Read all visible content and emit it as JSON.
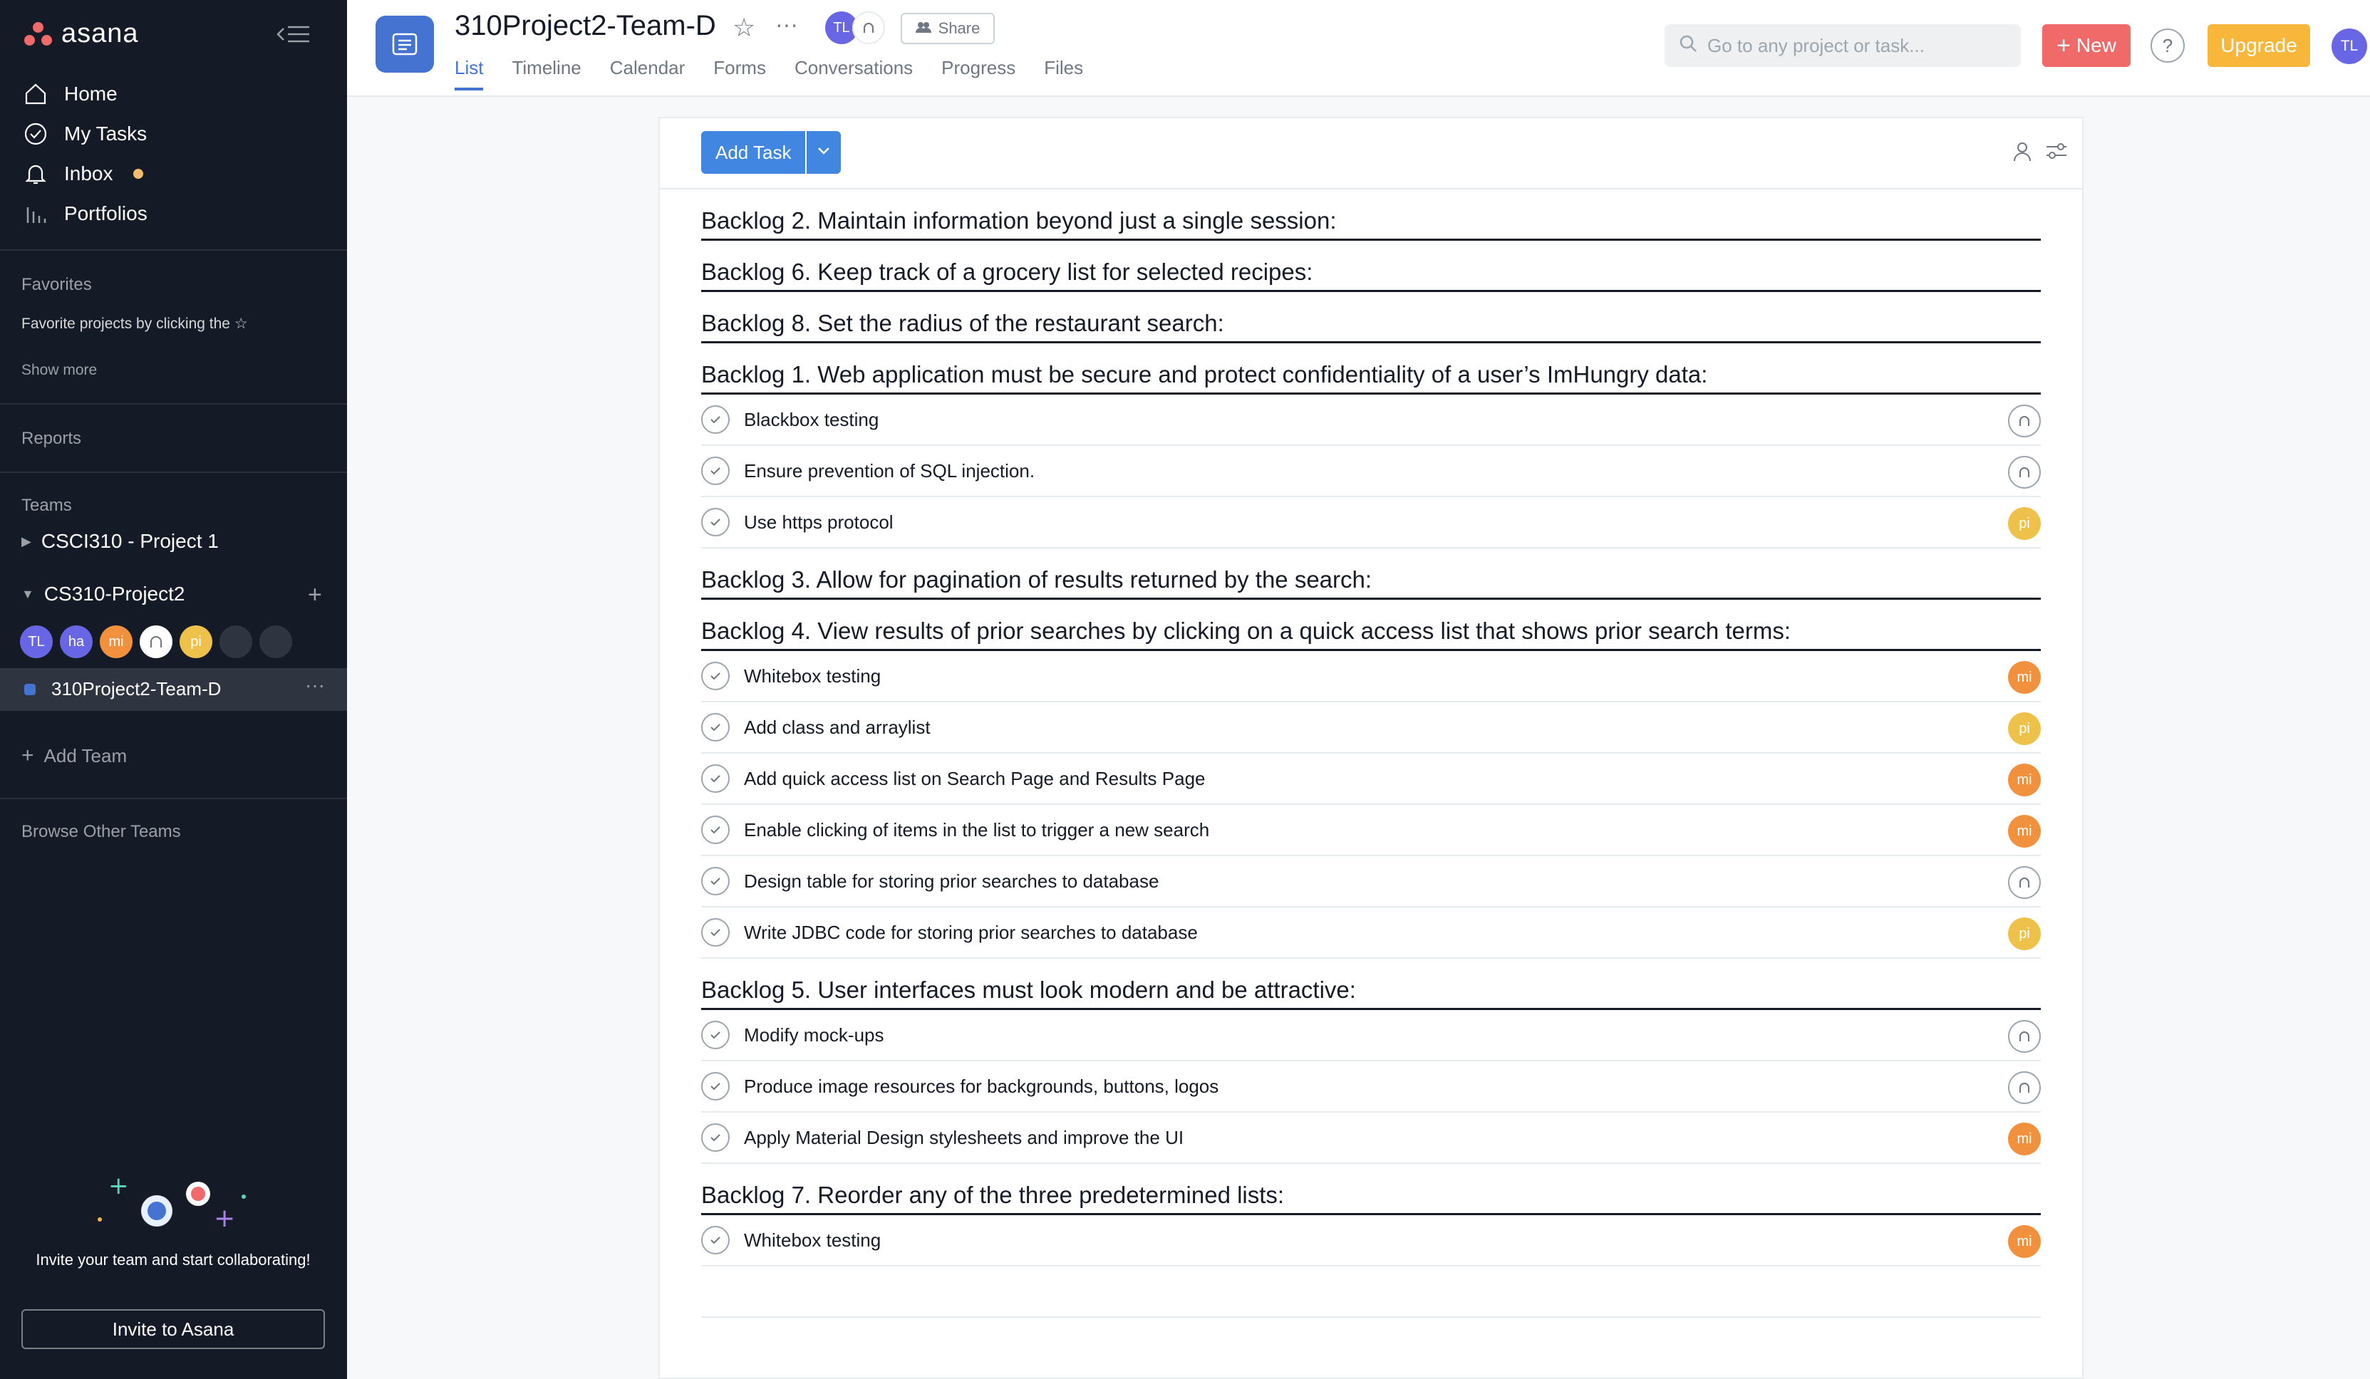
{
  "sidebar": {
    "logo": "asana",
    "nav": [
      {
        "label": "Home",
        "icon": "home-icon"
      },
      {
        "label": "My Tasks",
        "icon": "check-circle-icon"
      },
      {
        "label": "Inbox",
        "icon": "bell-icon"
      },
      {
        "label": "Portfolios",
        "icon": "bar-chart-icon"
      }
    ],
    "favorites_title": "Favorites",
    "favorites_hint": "Favorite projects by clicking the",
    "show_more": "Show more",
    "reports": "Reports",
    "teams_title": "Teams",
    "teams": [
      {
        "label": "CSCI310 - Project 1",
        "expanded": false
      },
      {
        "label": "CS310-Project2",
        "expanded": true
      }
    ],
    "team_members": [
      {
        "initials": "TL",
        "color": "#6966e6"
      },
      {
        "initials": "ha",
        "color": "#6966e6"
      },
      {
        "initials": "mi",
        "color": "#f1913d"
      },
      {
        "initials": "",
        "color": "#ffffff"
      },
      {
        "initials": "pi",
        "color": "#eec24a"
      },
      {
        "initials": "",
        "color": "#2f3441"
      },
      {
        "initials": "",
        "color": "#2f3441"
      }
    ],
    "project": "310Project2-Team-D",
    "add_team": "Add Team",
    "browse_teams": "Browse Other Teams",
    "invite_text": "Invite your team and start collaborating!",
    "invite_button": "Invite to Asana"
  },
  "header": {
    "title": "310Project2-Team-D",
    "owner_initials": "TL",
    "share": "Share",
    "tabs": [
      "List",
      "Timeline",
      "Calendar",
      "Forms",
      "Conversations",
      "Progress",
      "Files"
    ],
    "active_tab": "List",
    "search_placeholder": "Go to any project or task...",
    "new_button": "New",
    "help": "?",
    "upgrade": "Upgrade",
    "user_initials": "TL"
  },
  "toolbar": {
    "add_task": "Add Task"
  },
  "colors": {
    "mi": "#f1913d",
    "pi": "#eec24a",
    "accent": "#4573d2",
    "new": "#f06a6a",
    "upgrade": "#f8b73a"
  },
  "sections": [
    {
      "title": "Backlog 2. Maintain information beyond just a single session:",
      "tasks": []
    },
    {
      "title": "Backlog 6. Keep track of a grocery list for selected recipes:",
      "tasks": []
    },
    {
      "title": "Backlog 8. Set the radius of the restaurant search:",
      "tasks": []
    },
    {
      "title": "Backlog 1. Web application must be secure and protect confidentiality of a user’s ImHungry data:",
      "tasks": [
        {
          "name": "Blackbox testing",
          "assignee": ""
        },
        {
          "name": "Ensure prevention of SQL injection.",
          "assignee": ""
        },
        {
          "name": "Use https protocol",
          "assignee": "pi"
        }
      ]
    },
    {
      "title": "Backlog 3. Allow for pagination of results returned by the search:",
      "tasks": []
    },
    {
      "title": "Backlog 4. View results of prior searches by clicking on a quick access list that shows prior search terms:",
      "tasks": [
        {
          "name": "Whitebox testing",
          "assignee": "mi"
        },
        {
          "name": "Add class and arraylist",
          "assignee": "pi"
        },
        {
          "name": "Add quick access list on Search Page and Results Page",
          "assignee": "mi"
        },
        {
          "name": "Enable clicking of items in the list to trigger a new search",
          "assignee": "mi"
        },
        {
          "name": "Design table for storing prior searches to database",
          "assignee": ""
        },
        {
          "name": "Write JDBC code for storing prior searches to database",
          "assignee": "pi"
        }
      ]
    },
    {
      "title": "Backlog 5. User interfaces must look modern and be attractive:",
      "tasks": [
        {
          "name": "Modify mock-ups",
          "assignee": ""
        },
        {
          "name": "Produce image resources for backgrounds, buttons, logos",
          "assignee": ""
        },
        {
          "name": "Apply Material Design stylesheets and improve the UI",
          "assignee": "mi"
        }
      ]
    },
    {
      "title": "Backlog 7.  Reorder any of the three predetermined lists:",
      "tasks": [
        {
          "name": "Whitebox testing",
          "assignee": "mi"
        }
      ]
    }
  ]
}
